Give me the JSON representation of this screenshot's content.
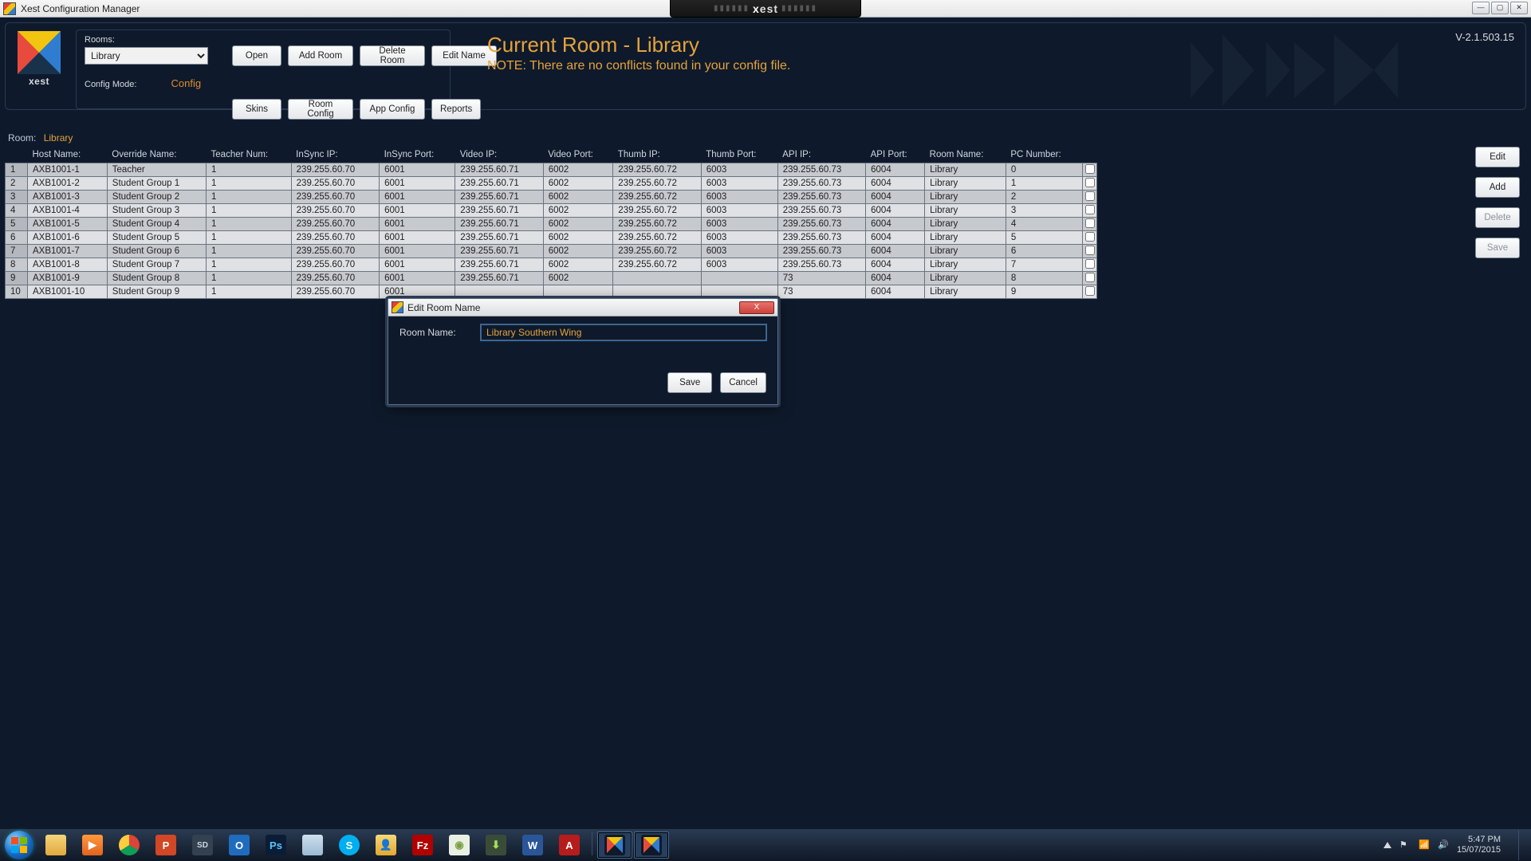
{
  "window": {
    "title": "Xest Configuration Manager",
    "brand": "xest",
    "version": "V-2.1.503.15"
  },
  "toolbar": {
    "rooms_label": "Rooms:",
    "room_selected": "Library",
    "open": "Open",
    "add_room": "Add Room",
    "delete_room": "Delete Room",
    "edit_name": "Edit Name",
    "config_mode_label": "Config Mode:",
    "config_mode_value": "Config",
    "skins": "Skins",
    "room_config": "Room Config",
    "app_config": "App Config",
    "reports": "Reports"
  },
  "header": {
    "title": "Current Room - Library",
    "note": "NOTE: There are no conflicts found in your config file."
  },
  "room_bar": {
    "label": "Room:",
    "value": "Library"
  },
  "columns": {
    "blank": "",
    "host": "Host Name:",
    "override": "Override Name:",
    "teacher": "Teacher Num:",
    "insync_ip": "InSync IP:",
    "insync_port": "InSync Port:",
    "video_ip": "Video IP:",
    "video_port": "Video Port:",
    "thumb_ip": "Thumb IP:",
    "thumb_port": "Thumb Port:",
    "api_ip": "API IP:",
    "api_port": "API Port:",
    "room_name": "Room Name:",
    "pc_num": "PC Number:"
  },
  "rows": [
    {
      "idx": "1",
      "host": "AXB1001-1",
      "override": "Teacher",
      "teacher": "1",
      "insync_ip": "239.255.60.70",
      "insync_port": "6001",
      "video_ip": "239.255.60.71",
      "video_port": "6002",
      "thumb_ip": "239.255.60.72",
      "thumb_port": "6003",
      "api_ip": "239.255.60.73",
      "api_port": "6004",
      "room": "Library",
      "pc": "0"
    },
    {
      "idx": "2",
      "host": "AXB1001-2",
      "override": "Student Group 1",
      "teacher": "1",
      "insync_ip": "239.255.60.70",
      "insync_port": "6001",
      "video_ip": "239.255.60.71",
      "video_port": "6002",
      "thumb_ip": "239.255.60.72",
      "thumb_port": "6003",
      "api_ip": "239.255.60.73",
      "api_port": "6004",
      "room": "Library",
      "pc": "1"
    },
    {
      "idx": "3",
      "host": "AXB1001-3",
      "override": "Student Group 2",
      "teacher": "1",
      "insync_ip": "239.255.60.70",
      "insync_port": "6001",
      "video_ip": "239.255.60.71",
      "video_port": "6002",
      "thumb_ip": "239.255.60.72",
      "thumb_port": "6003",
      "api_ip": "239.255.60.73",
      "api_port": "6004",
      "room": "Library",
      "pc": "2"
    },
    {
      "idx": "4",
      "host": "AXB1001-4",
      "override": "Student Group 3",
      "teacher": "1",
      "insync_ip": "239.255.60.70",
      "insync_port": "6001",
      "video_ip": "239.255.60.71",
      "video_port": "6002",
      "thumb_ip": "239.255.60.72",
      "thumb_port": "6003",
      "api_ip": "239.255.60.73",
      "api_port": "6004",
      "room": "Library",
      "pc": "3"
    },
    {
      "idx": "5",
      "host": "AXB1001-5",
      "override": "Student Group 4",
      "teacher": "1",
      "insync_ip": "239.255.60.70",
      "insync_port": "6001",
      "video_ip": "239.255.60.71",
      "video_port": "6002",
      "thumb_ip": "239.255.60.72",
      "thumb_port": "6003",
      "api_ip": "239.255.60.73",
      "api_port": "6004",
      "room": "Library",
      "pc": "4"
    },
    {
      "idx": "6",
      "host": "AXB1001-6",
      "override": "Student Group 5",
      "teacher": "1",
      "insync_ip": "239.255.60.70",
      "insync_port": "6001",
      "video_ip": "239.255.60.71",
      "video_port": "6002",
      "thumb_ip": "239.255.60.72",
      "thumb_port": "6003",
      "api_ip": "239.255.60.73",
      "api_port": "6004",
      "room": "Library",
      "pc": "5"
    },
    {
      "idx": "7",
      "host": "AXB1001-7",
      "override": "Student Group 6",
      "teacher": "1",
      "insync_ip": "239.255.60.70",
      "insync_port": "6001",
      "video_ip": "239.255.60.71",
      "video_port": "6002",
      "thumb_ip": "239.255.60.72",
      "thumb_port": "6003",
      "api_ip": "239.255.60.73",
      "api_port": "6004",
      "room": "Library",
      "pc": "6"
    },
    {
      "idx": "8",
      "host": "AXB1001-8",
      "override": "Student Group 7",
      "teacher": "1",
      "insync_ip": "239.255.60.70",
      "insync_port": "6001",
      "video_ip": "239.255.60.71",
      "video_port": "6002",
      "thumb_ip": "239.255.60.72",
      "thumb_port": "6003",
      "api_ip": "239.255.60.73",
      "api_port": "6004",
      "room": "Library",
      "pc": "7"
    },
    {
      "idx": "9",
      "host": "AXB1001-9",
      "override": "Student Group 8",
      "teacher": "1",
      "insync_ip": "239.255.60.70",
      "insync_port": "6001",
      "video_ip": "239.255.60.71",
      "video_port": "6002",
      "thumb_ip": "",
      "thumb_port": "",
      "api_ip": "73",
      "api_port": "6004",
      "room": "Library",
      "pc": "8"
    },
    {
      "idx": "10",
      "host": "AXB1001-10",
      "override": "Student Group 9",
      "teacher": "1",
      "insync_ip": "239.255.60.70",
      "insync_port": "6001",
      "video_ip": "",
      "video_port": "",
      "thumb_ip": "",
      "thumb_port": "",
      "api_ip": "73",
      "api_port": "6004",
      "room": "Library",
      "pc": "9"
    }
  ],
  "side": {
    "edit": "Edit",
    "add": "Add",
    "delete": "Delete",
    "save": "Save"
  },
  "modal": {
    "title": "Edit Room Name",
    "label": "Room Name:",
    "value": "Library Southern Wing",
    "save": "Save",
    "cancel": "Cancel",
    "close": "X"
  },
  "tray": {
    "time": "5:47 PM",
    "date": "15/07/2015"
  }
}
